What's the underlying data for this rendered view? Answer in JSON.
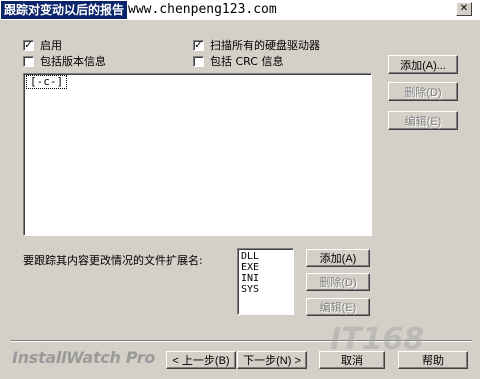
{
  "window": {
    "title": "跟踪对变动以后的报告",
    "url_overlay": "www.chenpeng123.com",
    "close_label": "✕"
  },
  "options": {
    "enable_label": "启用",
    "enable_checked": true,
    "scan_all_label": "扫描所有的硬盘驱动器",
    "scan_all_checked": true,
    "version_info_label": "包括版本信息",
    "version_info_checked": false,
    "crc_label": "包括 CRC 信息",
    "crc_checked": false
  },
  "drives": {
    "items": [
      "[-c-]"
    ]
  },
  "drive_buttons": {
    "add": "添加(A)...",
    "delete": "删除(D)",
    "edit": "编辑(E)"
  },
  "extensions": {
    "label": "要跟踪其内容更改情况的文件扩展名:",
    "items": [
      "DLL",
      "EXE",
      "INI",
      "SYS"
    ],
    "add": "添加(A)",
    "delete": "删除(D)",
    "edit": "编辑(E)"
  },
  "footer": {
    "brand": "InstallWatch Pro",
    "back": "< 上一步(B)",
    "next": "下一步(N) >",
    "cancel": "取消",
    "help": "帮助",
    "watermark": "IT168"
  }
}
